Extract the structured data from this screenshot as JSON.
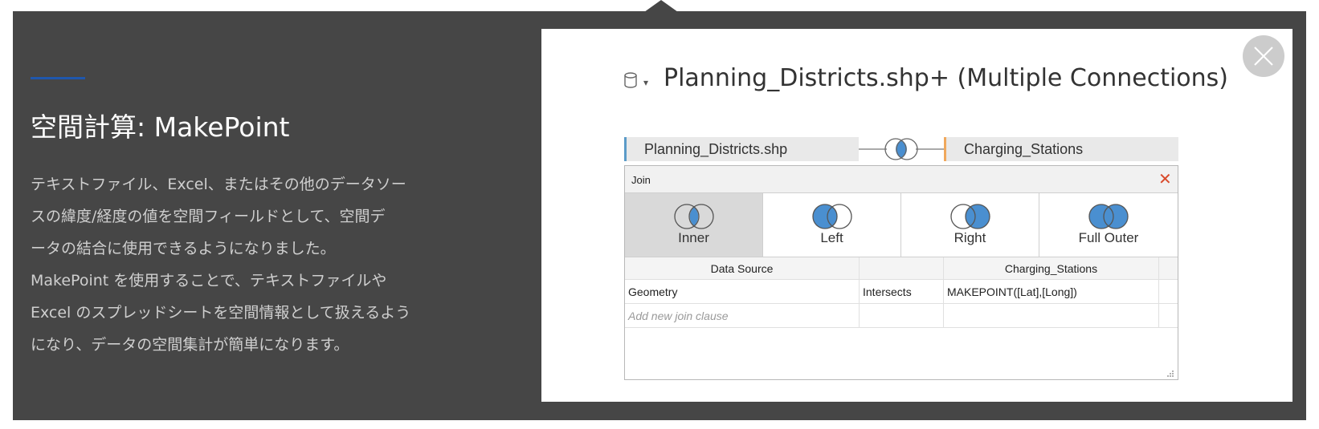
{
  "feature": {
    "title": "空間計算: MakePoint",
    "description_lines": [
      "テキストファイル、Excel、またはその他のデータソー",
      "スの緯度/経度の値を空間フィールドとして、空間デ",
      "ータの結合に使用できるようになりました。",
      "MakePoint を使用することで、テキストファイルや",
      "Excel のスプレッドシートを空間情報として扱えるよう",
      "になり、データの空間集計が簡単になります。"
    ]
  },
  "colors": {
    "panel_bg": "#464646",
    "accent": "#1f57ad",
    "venn_fill": "#4a8fd0",
    "left_table_marker": "#5b9bc8",
    "right_table_marker": "#f0a85c",
    "join_close": "#d94a2b"
  },
  "screenshot": {
    "datasource_icon": "database-icon",
    "datasource_title": "Planning_Districts.shp+ (Multiple Connections)",
    "left_table": "Planning_Districts.shp",
    "right_table": "Charging_Stations",
    "join_dialog": {
      "header": "Join",
      "close_icon": "close-x-icon",
      "types": [
        {
          "label": "Inner",
          "icon": "inner-join-icon",
          "selected": true
        },
        {
          "label": "Left",
          "icon": "left-join-icon",
          "selected": false
        },
        {
          "label": "Right",
          "icon": "right-join-icon",
          "selected": false
        },
        {
          "label": "Full Outer",
          "icon": "full-outer-join-icon",
          "selected": false
        }
      ],
      "columns": [
        "Data Source",
        "",
        "Charging_Stations"
      ],
      "clauses": [
        {
          "left": "Geometry",
          "operator": "Intersects",
          "right": "MAKEPOINT([Lat],[Long])"
        }
      ],
      "add_placeholder": "Add new join clause"
    }
  }
}
